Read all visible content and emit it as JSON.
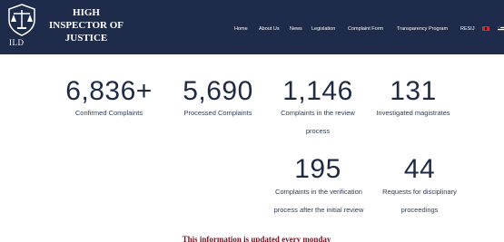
{
  "header": {
    "logo_text": "ILD",
    "brand_title": "HIGH INSPECTOR OF JUSTICE",
    "nav": [
      "Home",
      "About Us",
      "News",
      "Legislation",
      "Complaint Form",
      "Transparency Program",
      "RESIJ"
    ],
    "languages": [
      "flag-albania-icon",
      "flag-usa-icon"
    ]
  },
  "stats": [
    {
      "value": "6,836+",
      "label": "Confirmed Complaints"
    },
    {
      "value": "5,690",
      "label": "Processed Complaints"
    },
    {
      "value": "1,146",
      "label": "Complaints in the review process"
    },
    {
      "value": "131",
      "label": "Investigated magistrates"
    },
    {
      "value": "195",
      "label": "Complaints in the verification process after the initial review"
    },
    {
      "value": "44",
      "label": "Requests for disciplinary proceedings"
    }
  ],
  "notice": "This information is updated every monday",
  "colors": {
    "header_bg": "#1e2b4a",
    "number": "#1f2a44",
    "notice": "#7a1020"
  }
}
